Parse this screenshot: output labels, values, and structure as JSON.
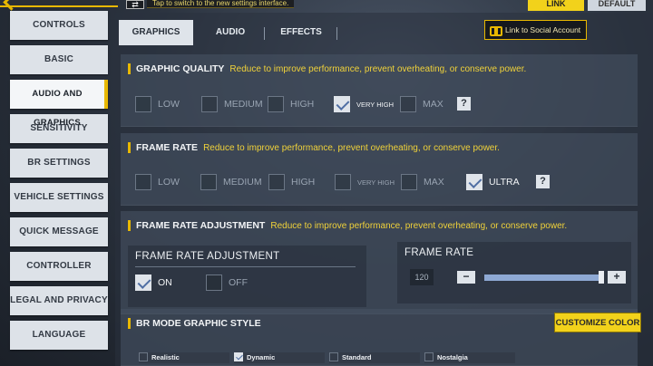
{
  "topbar": {
    "switch_icon": "⇄",
    "hint": "Tap to switch to the new settings interface.",
    "link_label": "LINK",
    "default_label": "DEFAULT"
  },
  "sidebar": {
    "items": [
      {
        "label": "CONTROLS"
      },
      {
        "label": "BASIC"
      },
      {
        "label": "AUDIO AND GRAPHICS",
        "active": true
      },
      {
        "label": "SENSITIVITY"
      },
      {
        "label": "BR SETTINGS"
      },
      {
        "label": "VEHICLE SETTINGS"
      },
      {
        "label": "QUICK MESSAGE"
      },
      {
        "label": "CONTROLLER"
      },
      {
        "label": "LEGAL AND PRIVACY"
      },
      {
        "label": "LANGUAGE"
      }
    ]
  },
  "tabs": [
    {
      "label": "GRAPHICS",
      "active": true
    },
    {
      "label": "AUDIO"
    },
    {
      "label": "EFFECTS"
    }
  ],
  "social_link": "Link to Social Account",
  "graphic_quality": {
    "title": "GRAPHIC QUALITY",
    "desc": "Reduce to improve performance, prevent overheating, or conserve power.",
    "options": [
      "LOW",
      "MEDIUM",
      "HIGH",
      "VERY HIGH",
      "MAX"
    ],
    "selected": "VERY HIGH",
    "help": "?"
  },
  "frame_rate": {
    "title": "FRAME RATE",
    "desc": "Reduce to improve performance, prevent overheating, or conserve power.",
    "options": [
      "LOW",
      "MEDIUM",
      "HIGH",
      "VERY HIGH",
      "MAX",
      "ULTRA"
    ],
    "selected": "ULTRA",
    "help": "?"
  },
  "frame_rate_adjustment": {
    "title": "FRAME RATE ADJUSTMENT",
    "desc": "Reduce to improve performance, prevent overheating, or conserve power.",
    "toggle_title": "FRAME RATE ADJUSTMENT",
    "on_label": "ON",
    "off_label": "OFF",
    "selected": "ON",
    "slider_title": "FRAME RATE",
    "value": "120",
    "minus": "−",
    "plus": "+"
  },
  "br_mode": {
    "title": "BR MODE GRAPHIC STYLE",
    "customize_label": "CUSTOMIZE COLOR",
    "styles": [
      "Realistic",
      "Dynamic",
      "Standard",
      "Nostalgia"
    ],
    "selected": "Dynamic"
  },
  "colors": {
    "accent": "#f2d21b",
    "desc_text": "#f0d23a",
    "check": "#4f6ea3",
    "slider": "#8ea9d4"
  }
}
